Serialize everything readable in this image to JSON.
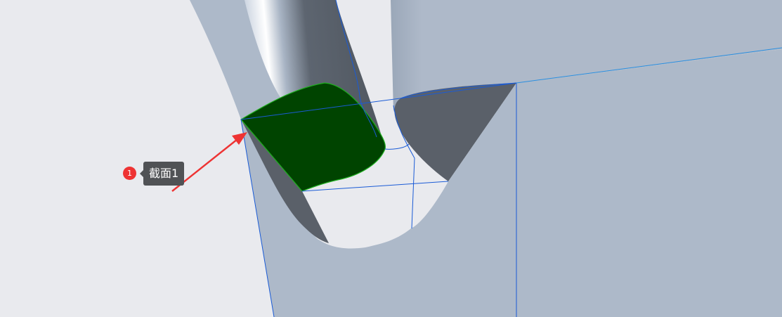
{
  "annotation": {
    "badge_number": "1",
    "label": "截面1"
  },
  "colors": {
    "background": "#e9eaee",
    "body_surface": "#adb9c9",
    "shadow_face": "#5a6069",
    "section_fill": "#004400",
    "section_edge": "#1fae1f",
    "edge_lines": "#1a5bd6",
    "arrow": "#ee3333",
    "badge": "#ee3333",
    "callout_bg": "#505255"
  },
  "icons": {
    "arrow": "arrow-icon"
  }
}
